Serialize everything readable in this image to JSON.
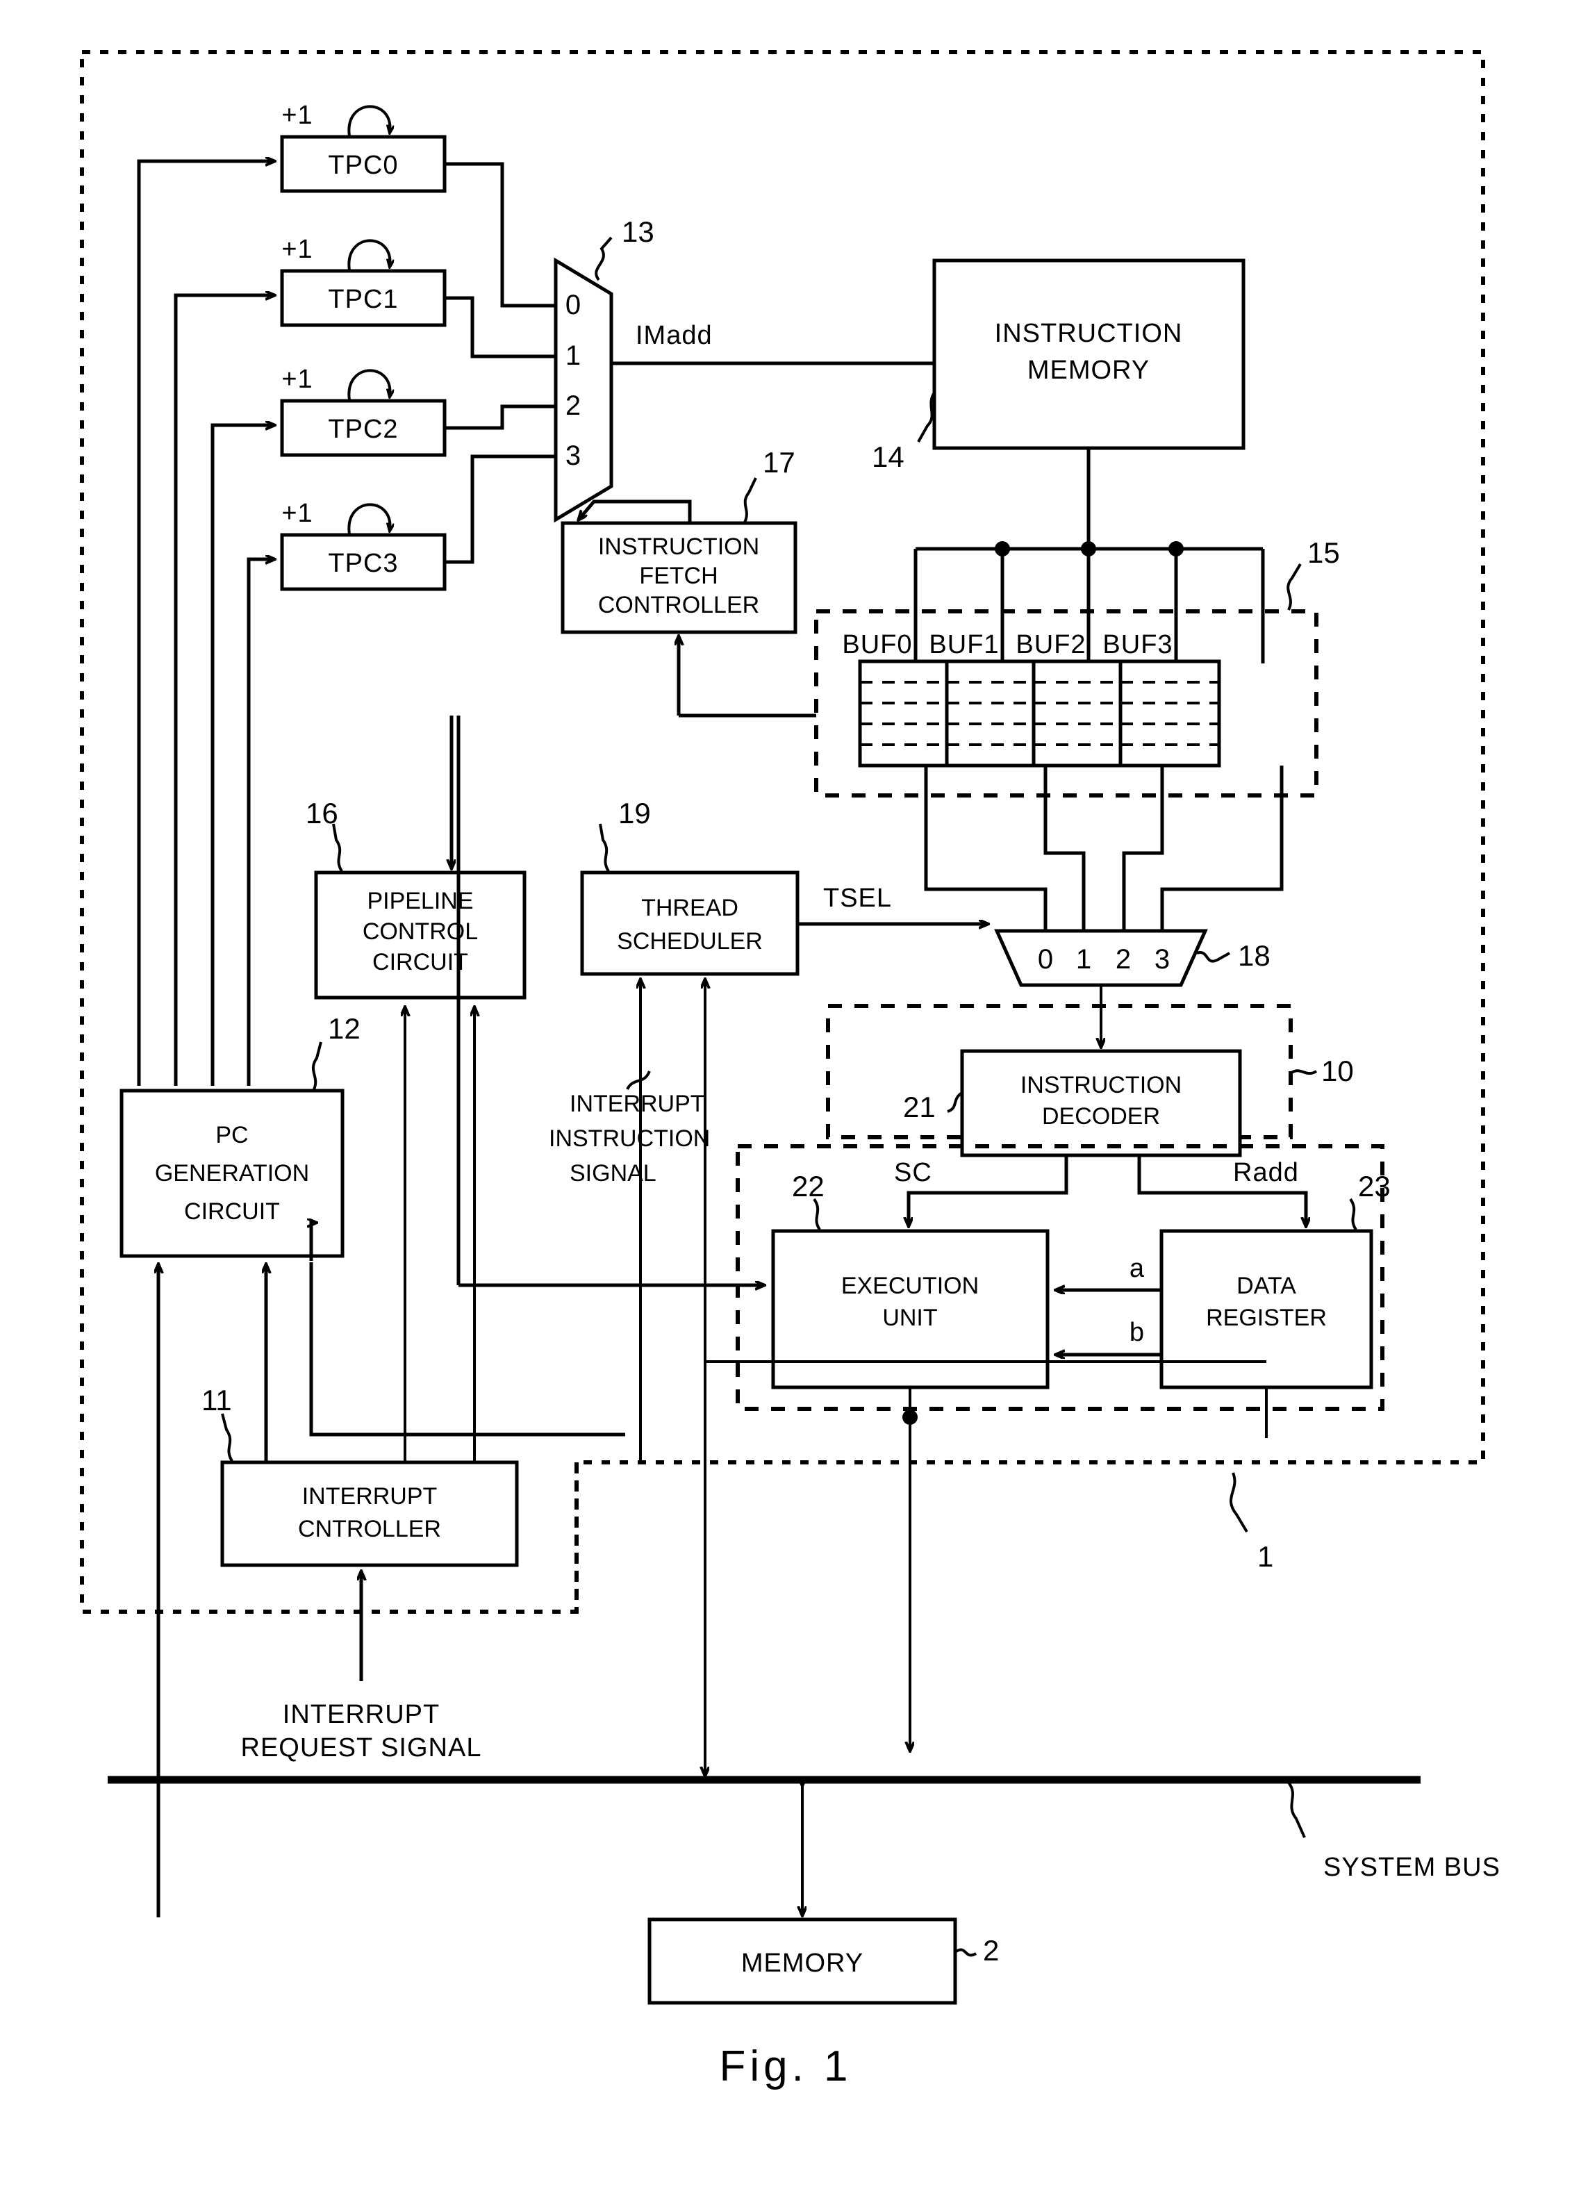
{
  "figure": {
    "caption": "Fig. 1"
  },
  "blocks": {
    "tpc0": "TPC0",
    "tpc1": "TPC1",
    "tpc2": "TPC2",
    "tpc3": "TPC3",
    "instruction_memory": [
      "INSTRUCTION",
      "MEMORY"
    ],
    "instruction_fetch_controller": [
      "INSTRUCTION",
      "FETCH",
      "CONTROLLER"
    ],
    "pipeline_control_circuit": [
      "PIPELINE",
      "CONTROL",
      "CIRCUIT"
    ],
    "thread_scheduler": [
      "THREAD",
      "SCHEDULER"
    ],
    "pc_generation_circuit": [
      "PC",
      "GENERATION",
      "CIRCUIT"
    ],
    "instruction_decoder": [
      "INSTRUCTION",
      "DECODER"
    ],
    "execution_unit": [
      "EXECUTION",
      "UNIT"
    ],
    "data_register": [
      "DATA",
      "REGISTER"
    ],
    "interrupt_cntroller": [
      "INTERRUPT",
      "CNTROLLER"
    ],
    "memory": "MEMORY",
    "buffers": [
      "BUF0",
      "BUF1",
      "BUF2",
      "BUF3"
    ]
  },
  "signals": {
    "imadd": "IMadd",
    "tsel": "TSEL",
    "sc": "SC",
    "radd": "Radd",
    "port_a": "a",
    "port_b": "b",
    "increment": "+1",
    "interrupt_instruction_signal": [
      "INTERRUPT",
      "INSTRUCTION",
      "SIGNAL"
    ],
    "interrupt_request_signal": [
      "INTERRUPT",
      "REQUEST SIGNAL"
    ],
    "system_bus": "SYSTEM BUS"
  },
  "mux_ports": {
    "mux13": [
      "0",
      "1",
      "2",
      "3"
    ],
    "mux18": [
      "0",
      "1",
      "2",
      "3"
    ]
  },
  "reference_numerals": {
    "n1": "1",
    "n2": "2",
    "n10": "10",
    "n11": "11",
    "n12": "12",
    "n13": "13",
    "n14": "14",
    "n15": "15",
    "n16": "16",
    "n17": "17",
    "n18": "18",
    "n19": "19",
    "n21": "21",
    "n22": "22",
    "n23": "23"
  },
  "colors": {
    "ink": "#000000",
    "paper": "#ffffff"
  }
}
